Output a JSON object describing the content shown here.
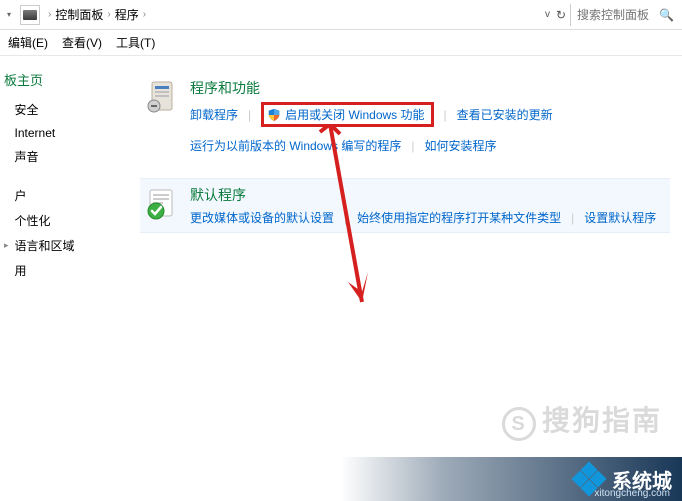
{
  "addressBar": {
    "breadcrumb": {
      "item1": "控制面板",
      "item2": "程序"
    },
    "search": {
      "placeholder": "搜索控制面板"
    }
  },
  "menuBar": {
    "edit": "编辑(E)",
    "view": "查看(V)",
    "tools": "工具(T)"
  },
  "sidebar": {
    "title": "板主页",
    "items": [
      {
        "label": "安全",
        "hasSub": false
      },
      {
        "label": "Internet",
        "hasSub": false
      },
      {
        "label": "声音",
        "hasSub": false
      },
      {
        "label": "",
        "hasSub": false,
        "hidden": true
      },
      {
        "label": "户",
        "hasSub": false
      },
      {
        "label": "个性化",
        "hasSub": false
      },
      {
        "label": "语言和区域",
        "hasSub": true
      },
      {
        "label": "用",
        "hasSub": false
      }
    ]
  },
  "content": {
    "programsFeatures": {
      "title": "程序和功能",
      "links": {
        "uninstall": "卸载程序",
        "windowsFeatures": "启用或关闭 Windows 功能",
        "viewUpdates": "查看已安装的更新",
        "runOld": "运行为以前版本的 Windows 编写的程序",
        "howInstall": "如何安装程序"
      }
    },
    "defaultPrograms": {
      "title": "默认程序",
      "links": {
        "changeMedia": "更改媒体或设备的默认设置",
        "alwaysOpen": "始终使用指定的程序打开某种文件类型",
        "setDefault": "设置默认程序"
      }
    }
  },
  "watermarks": {
    "sogou": "搜狗指南",
    "brand": "系统城",
    "url": "xitongcheng.com"
  }
}
